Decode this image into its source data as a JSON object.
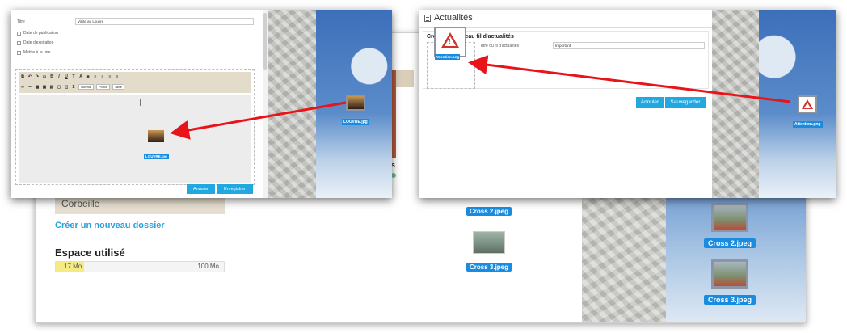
{
  "background": {
    "trash_label": "Corbeille",
    "create_folder_link": "Créer un nouveau dossier",
    "storage_title": "Espace utilisé",
    "storage_used": "17 Mo",
    "storage_total": "100 Mo",
    "storage_fraction": 0.17,
    "partial_text": "ss",
    "files": [
      {
        "name": "Cross 2.jpeg"
      },
      {
        "name": "Cross 3.jpeg"
      }
    ],
    "desktop_files": [
      {
        "name": "Cross 2.jpeg"
      },
      {
        "name": "Cross 3.jpeg"
      }
    ]
  },
  "editor_popup": {
    "title_label": "Titre",
    "title_value": "Visite au Louvre",
    "checkboxes": [
      {
        "label": "Date de publication"
      },
      {
        "label": "Date d'expiration"
      },
      {
        "label": "Mettre à la une"
      }
    ],
    "toolbar": {
      "format_select": "Normal",
      "font_select": "Police",
      "size_select": "Taille",
      "buttons": [
        "B",
        "I",
        "U",
        "T",
        "A",
        "Σ"
      ]
    },
    "dropped_file": "LOUVRE.jpg",
    "desktop_file": "LOUVRE.jpg",
    "cancel_button": "Annuler",
    "save_button": "Enregistrer"
  },
  "news_popup": {
    "window_title": "Actualités",
    "section_title": "Créer un nouveau fil d'actualités",
    "field_label": "Titre du fil d'actualités",
    "field_value": "Important",
    "dropped_file": "Attention.png",
    "desktop_file": "Attention.png",
    "cancel_button": "Annuler",
    "save_button": "Sauvegarder"
  },
  "colors": {
    "accent": "#21a8e0",
    "badge": "#1a8ce0",
    "arrow": "#e8141a",
    "storage_fill": "#f6eb82"
  }
}
